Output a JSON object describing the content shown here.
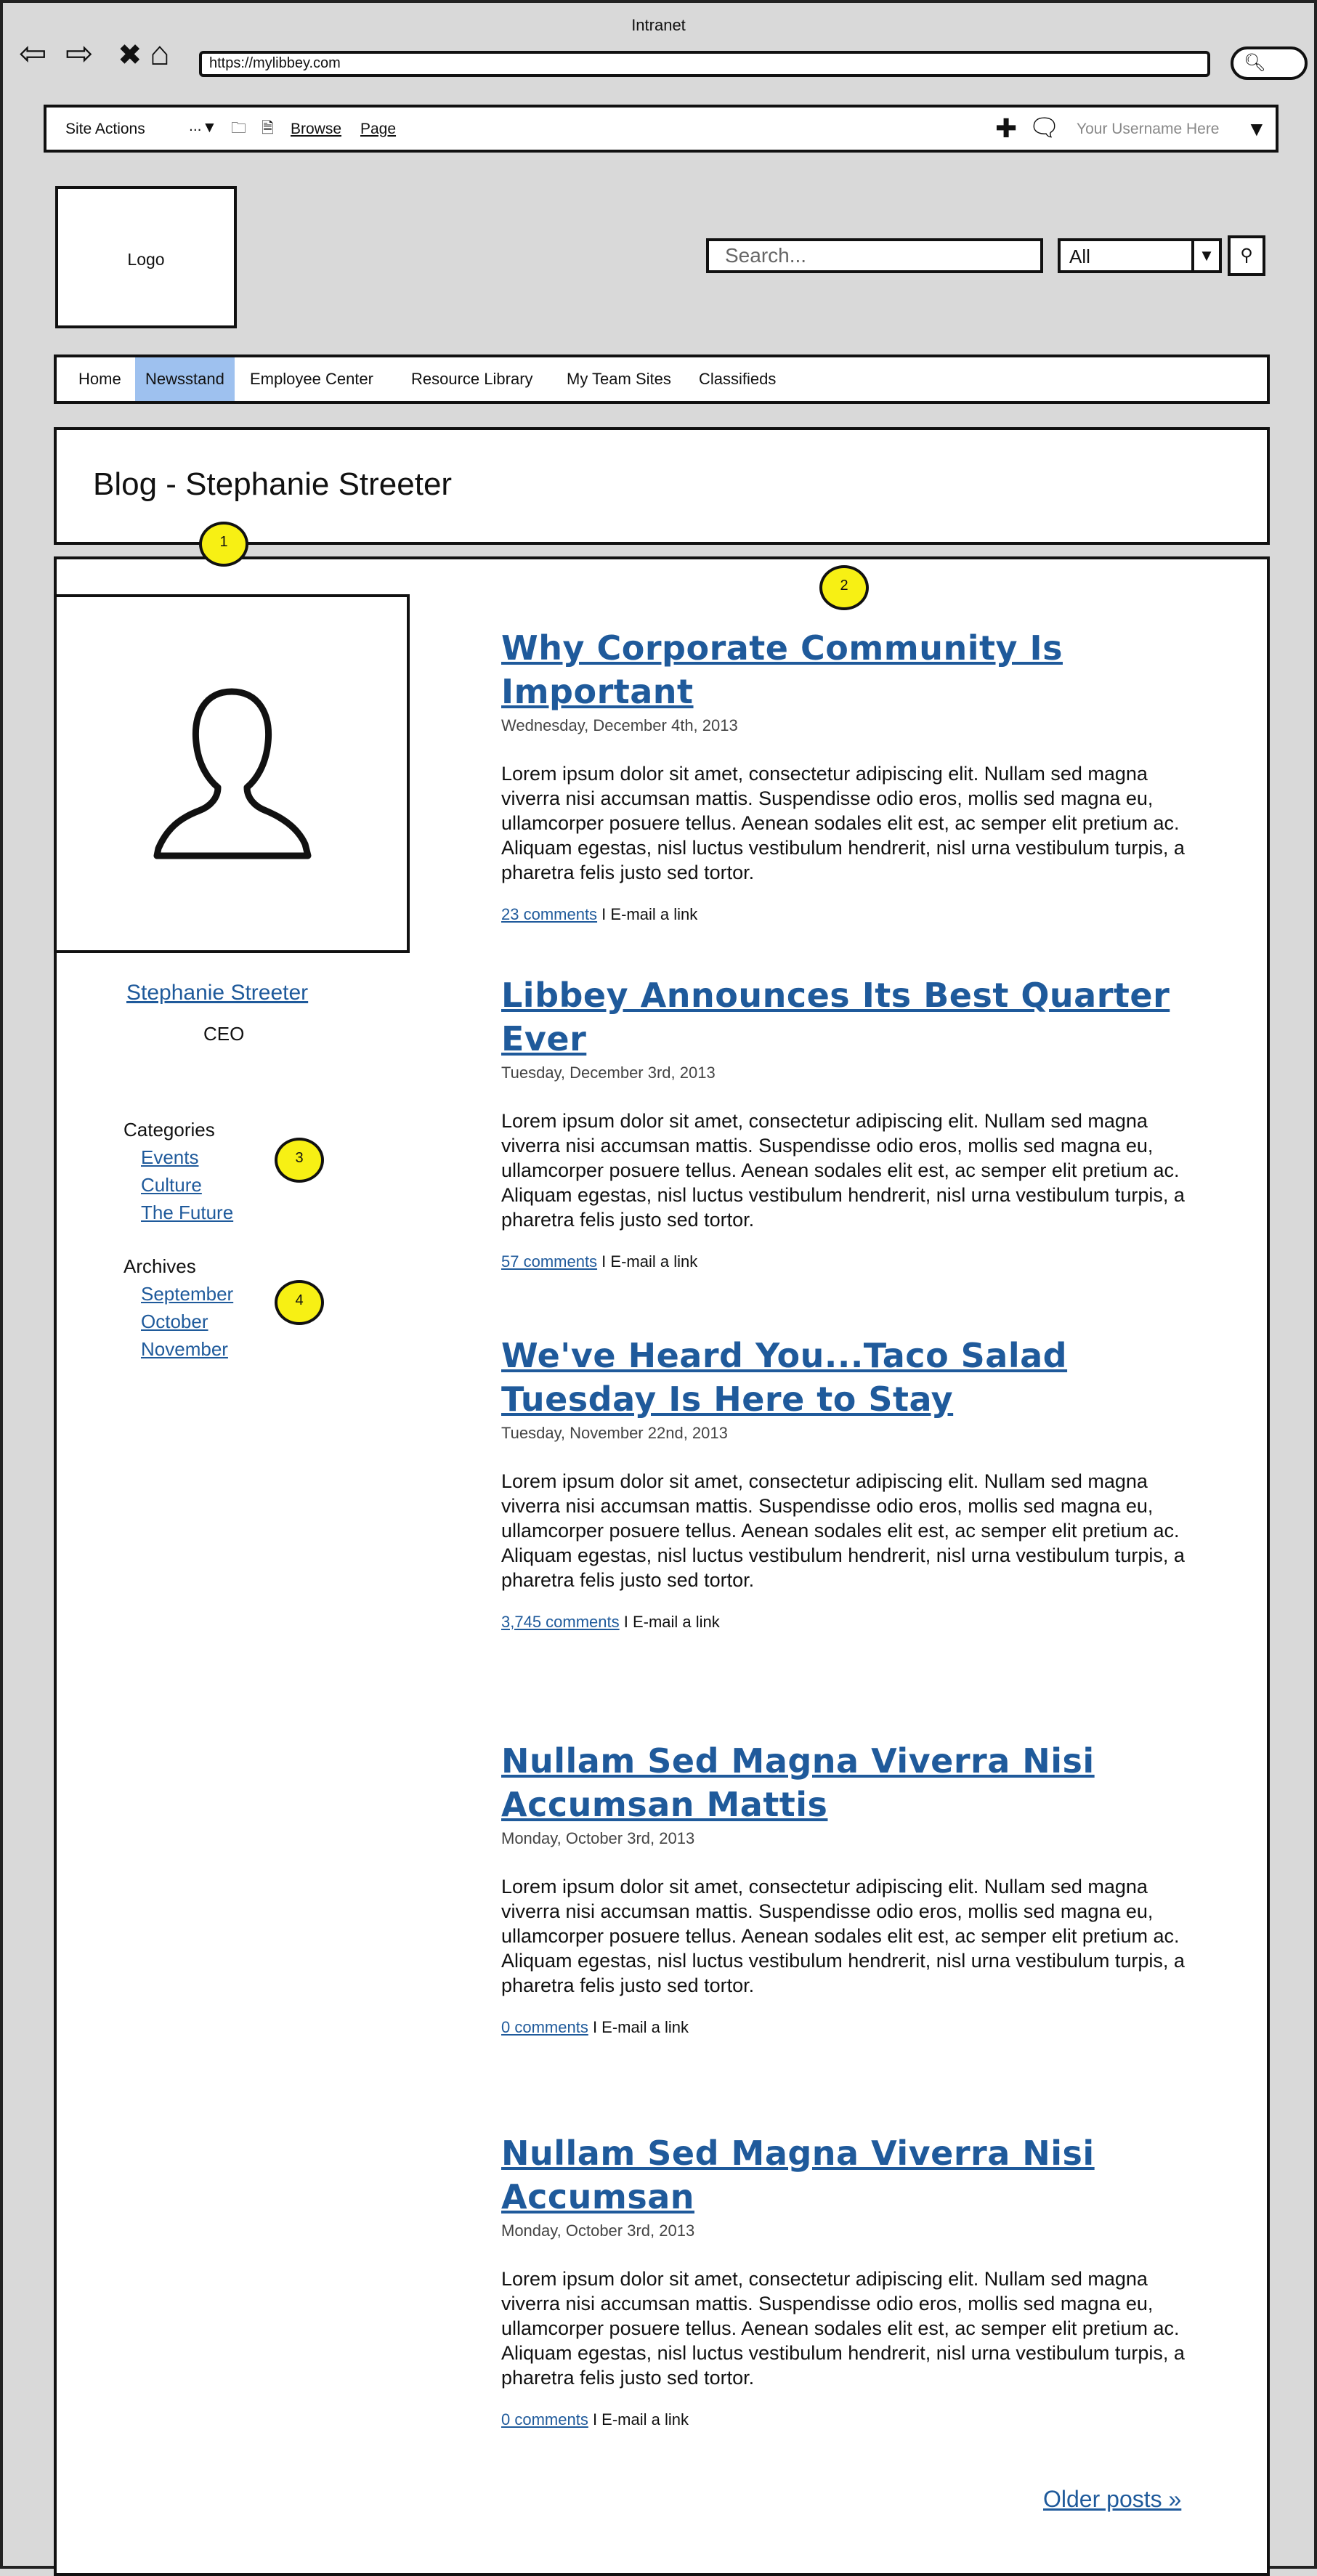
{
  "browser": {
    "window_title": "Intranet",
    "url": "https://mylibbey.com",
    "back_glyph": "⇦",
    "forward_glyph": "⇨",
    "stop_glyph": "✖",
    "home_glyph": "⌂",
    "search_glyph": "🔍︎"
  },
  "actions_bar": {
    "site_actions": "Site Actions",
    "dots": "...",
    "browse": "Browse",
    "page": "Page",
    "username": "Your Username Here"
  },
  "header": {
    "logo": "Logo",
    "search_placeholder": "Search...",
    "scope_value": "All"
  },
  "nav": {
    "items": [
      {
        "label": "Home"
      },
      {
        "label": "Newsstand"
      },
      {
        "label": "Employee Center"
      },
      {
        "label": "Resource Library"
      },
      {
        "label": "My Team Sites"
      },
      {
        "label": "Classifieds"
      }
    ],
    "active_index": 1
  },
  "page": {
    "title": "Blog - Stephanie Streeter"
  },
  "annotations": [
    "1",
    "2",
    "3",
    "4"
  ],
  "sidebar": {
    "author_name": "Stephanie Streeter",
    "author_role": "CEO",
    "categories_label": "Categories",
    "categories": [
      "Events",
      "Culture",
      "The Future"
    ],
    "archives_label": "Archives",
    "archives": [
      "September",
      "October",
      "November"
    ]
  },
  "posts": [
    {
      "title": "Why Corporate Community Is Important",
      "date": "Wednesday, December 4th, 2013",
      "body": "Lorem ipsum dolor sit amet, consectetur adipiscing elit. Nullam sed magna viverra nisi accumsan mattis. Suspendisse odio eros, mollis sed magna eu, ullamcorper posuere tellus. Aenean sodales elit est, ac semper elit pretium ac. Aliquam egestas, nisl luctus vestibulum hendrerit, nisl urna vestibulum turpis, a pharetra felis justo sed tortor.",
      "comments": "23 comments",
      "separator": " I ",
      "email": "E-mail a link"
    },
    {
      "title": "Libbey Announces Its Best Quarter Ever",
      "date": "Tuesday, December 3rd, 2013",
      "body": "Lorem ipsum dolor sit amet, consectetur adipiscing elit. Nullam sed magna viverra nisi accumsan mattis. Suspendisse odio eros, mollis sed magna eu, ullamcorper posuere tellus. Aenean sodales elit est, ac semper elit pretium ac. Aliquam egestas, nisl luctus vestibulum hendrerit, nisl urna vestibulum turpis, a pharetra felis justo sed tortor.",
      "comments": "57 comments",
      "separator": " I ",
      "email": "E-mail a link"
    },
    {
      "title": "We've Heard You...Taco Salad Tuesday Is Here to Stay",
      "date": "Tuesday, November 22nd, 2013",
      "body": "Lorem ipsum dolor sit amet, consectetur adipiscing elit. Nullam sed magna viverra nisi accumsan mattis. Suspendisse odio eros, mollis sed magna eu, ullamcorper posuere tellus. Aenean sodales elit est, ac semper elit pretium ac. Aliquam egestas, nisl luctus vestibulum hendrerit, nisl urna vestibulum turpis, a pharetra felis justo sed tortor.",
      "comments": "3,745 comments",
      "separator": " I ",
      "email": "E-mail a link"
    },
    {
      "title": "Nullam Sed Magna Viverra Nisi Accumsan Mattis",
      "date": "Monday, October 3rd, 2013",
      "body": "Lorem ipsum dolor sit amet, consectetur adipiscing elit. Nullam sed magna viverra nisi accumsan mattis. Suspendisse odio eros, mollis sed magna eu, ullamcorper posuere tellus. Aenean sodales elit est, ac semper elit pretium ac. Aliquam egestas, nisl luctus vestibulum hendrerit, nisl urna vestibulum turpis, a pharetra felis justo sed tortor.",
      "comments": "0 comments",
      "separator": " I ",
      "email": "E-mail a link"
    },
    {
      "title": "Nullam Sed Magna Viverra Nisi Accumsan",
      "date": "Monday, October 3rd, 2013",
      "body": "Lorem ipsum dolor sit amet, consectetur adipiscing elit. Nullam sed magna viverra nisi accumsan mattis. Suspendisse odio eros, mollis sed magna eu, ullamcorper posuere tellus. Aenean sodales elit est, ac semper elit pretium ac. Aliquam egestas, nisl luctus vestibulum hendrerit, nisl urna vestibulum turpis, a pharetra felis justo sed tortor.",
      "comments": "0 comments",
      "separator": " I ",
      "email": "E-mail a link"
    }
  ],
  "pagination": {
    "older": "Older posts »"
  },
  "colors": {
    "link": "#1f5a9b",
    "nav_active": "#9ec1ef",
    "annotation": "#f7f014",
    "background": "#d9d9d9"
  }
}
